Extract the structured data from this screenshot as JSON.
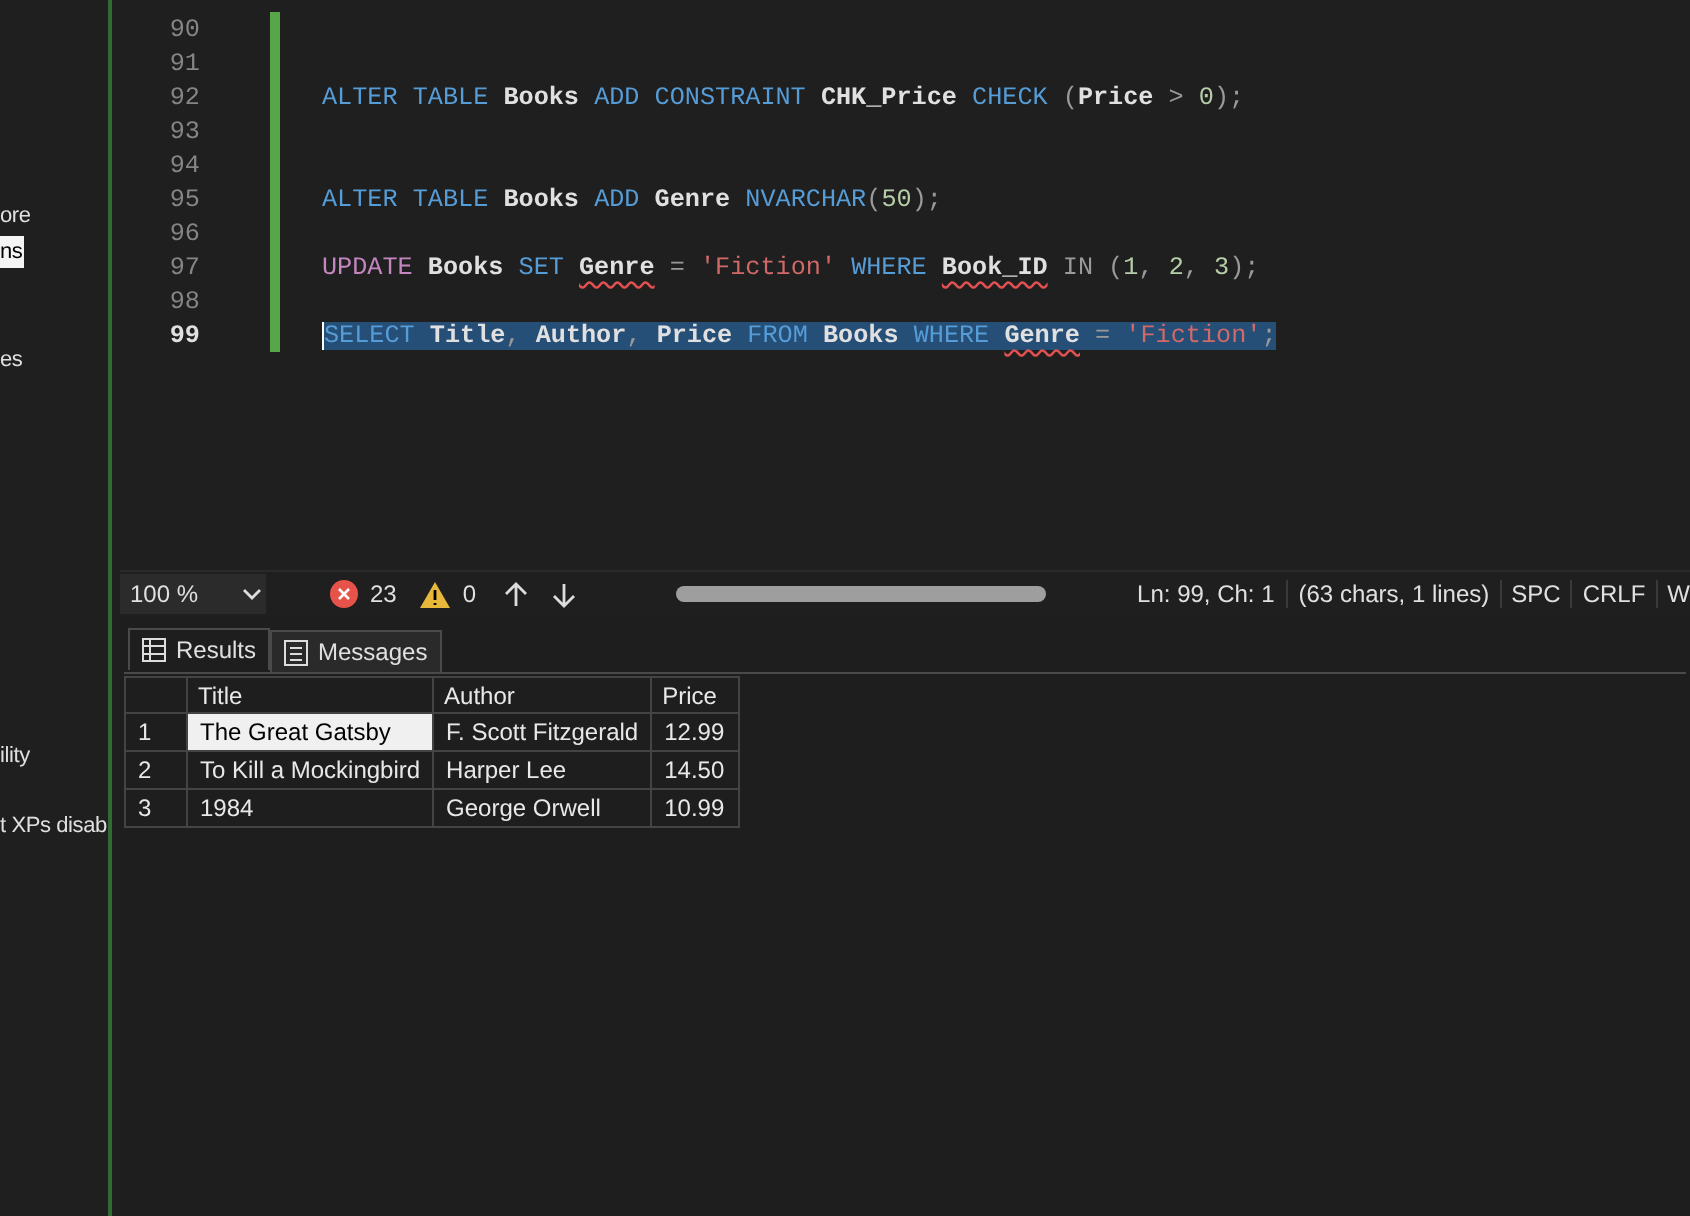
{
  "sidebar": {
    "items": [
      {
        "label": "ore",
        "selected": false
      },
      {
        "label": "ns",
        "selected": true
      },
      {
        "label": "es",
        "selected": false
      },
      {
        "label": "ility",
        "selected": false
      },
      {
        "label": "t XPs disab",
        "selected": false
      }
    ]
  },
  "editor": {
    "lines": [
      {
        "number": "90",
        "selected": false
      },
      {
        "number": "91",
        "selected": false
      },
      {
        "number": "92",
        "selected": false,
        "tokens": [
          {
            "kind": "keyword",
            "text": "ALTER TABLE "
          },
          {
            "kind": "ident",
            "text": "Books "
          },
          {
            "kind": "keyword",
            "text": "ADD CONSTRAINT "
          },
          {
            "kind": "ident",
            "text": "CHK_Price "
          },
          {
            "kind": "keyword",
            "text": "CHECK "
          },
          {
            "kind": "op",
            "text": "("
          },
          {
            "kind": "ident",
            "text": "Price "
          },
          {
            "kind": "op",
            "text": "> "
          },
          {
            "kind": "number",
            "text": "0"
          },
          {
            "kind": "op",
            "text": ");"
          }
        ]
      },
      {
        "number": "93",
        "selected": false
      },
      {
        "number": "94",
        "selected": false
      },
      {
        "number": "95",
        "selected": false,
        "tokens": [
          {
            "kind": "keyword",
            "text": "ALTER TABLE "
          },
          {
            "kind": "ident",
            "text": "Books "
          },
          {
            "kind": "keyword",
            "text": "ADD "
          },
          {
            "kind": "ident",
            "text": "Genre "
          },
          {
            "kind": "keyword",
            "text": "NVARCHAR"
          },
          {
            "kind": "op",
            "text": "("
          },
          {
            "kind": "number",
            "text": "50"
          },
          {
            "kind": "op",
            "text": ");"
          }
        ]
      },
      {
        "number": "96",
        "selected": false
      },
      {
        "number": "97",
        "selected": false,
        "tokens": [
          {
            "kind": "control",
            "text": "UPDATE "
          },
          {
            "kind": "ident",
            "text": "Books "
          },
          {
            "kind": "keyword",
            "text": "SET "
          },
          {
            "kind": "ident",
            "text": "Genre",
            "squiggle": true
          },
          {
            "kind": "op",
            "text": " = "
          },
          {
            "kind": "string",
            "text": "'Fiction' "
          },
          {
            "kind": "keyword",
            "text": "WHERE "
          },
          {
            "kind": "ident",
            "text": "Book_ID",
            "squiggle": true
          },
          {
            "kind": "op",
            "text": " IN ("
          },
          {
            "kind": "number",
            "text": "1"
          },
          {
            "kind": "op",
            "text": ", "
          },
          {
            "kind": "number",
            "text": "2"
          },
          {
            "kind": "op",
            "text": ", "
          },
          {
            "kind": "number",
            "text": "3"
          },
          {
            "kind": "op",
            "text": ");"
          }
        ]
      },
      {
        "number": "98",
        "selected": false
      },
      {
        "number": "99",
        "selected": true,
        "tokens": [
          {
            "kind": "keyword",
            "text": "SELECT "
          },
          {
            "kind": "ident",
            "text": "Title"
          },
          {
            "kind": "op",
            "text": ", "
          },
          {
            "kind": "ident",
            "text": "Author"
          },
          {
            "kind": "op",
            "text": ", "
          },
          {
            "kind": "ident",
            "text": "Price "
          },
          {
            "kind": "keyword",
            "text": "FROM "
          },
          {
            "kind": "ident",
            "text": "Books "
          },
          {
            "kind": "keyword",
            "text": "WHERE "
          },
          {
            "kind": "ident",
            "text": "Genre",
            "squiggle": true
          },
          {
            "kind": "op",
            "text": " = "
          },
          {
            "kind": "string",
            "text": "'Fiction'"
          },
          {
            "kind": "op",
            "text": ";"
          }
        ]
      }
    ]
  },
  "status_bar": {
    "zoom": "100 %",
    "errors": "23",
    "warnings": "0",
    "position": "Ln: 99, Ch: 1",
    "selection": "(63 chars, 1 lines)",
    "indent": "SPC",
    "line_ending": "CRLF",
    "encoding": "W"
  },
  "result_tabs": [
    {
      "label": "Results",
      "selected": true
    },
    {
      "label": "Messages",
      "selected": false
    }
  ],
  "table": {
    "columns": [
      "Title",
      "Author",
      "Price"
    ],
    "rows": [
      {
        "number": "1",
        "cells": [
          {
            "text": "The Great Gatsby",
            "selected": true
          },
          {
            "text": "F. Scott Fitzgerald",
            "selected": false
          },
          {
            "text": "12.99",
            "selected": false
          }
        ]
      },
      {
        "number": "2",
        "cells": [
          {
            "text": "To Kill a Mockingbird",
            "selected": false
          },
          {
            "text": "Harper Lee",
            "selected": false
          },
          {
            "text": "14.50",
            "selected": false
          }
        ]
      },
      {
        "number": "3",
        "cells": [
          {
            "text": "1984",
            "selected": false
          },
          {
            "text": "George Orwell",
            "selected": false
          },
          {
            "text": "10.99",
            "selected": false
          }
        ]
      }
    ]
  }
}
